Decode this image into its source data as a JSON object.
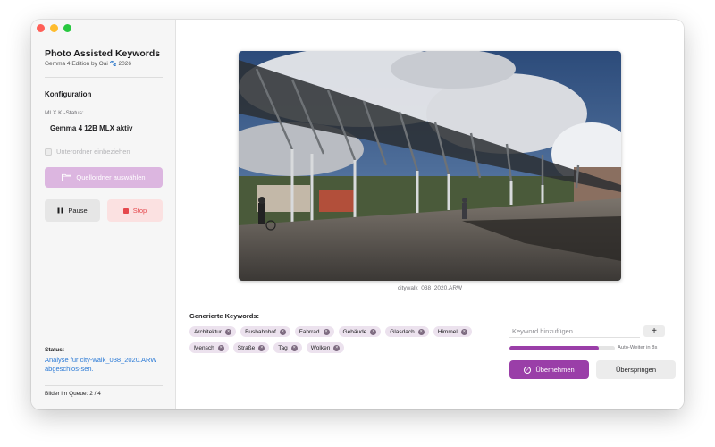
{
  "app": {
    "title": "Photo Assisted Keywords",
    "subtitle": "Gemma 4 Edition by Oai 🐾 2026"
  },
  "sidebar": {
    "config_heading": "Konfiguration",
    "mlx_label": "MLX KI-Status:",
    "mlx_value": "Gemma 4 12B MLX aktiv",
    "subfolder_label": "Unterordner einbeziehen",
    "subfolder_checked": false,
    "folder_button": "Quellordner auswählen",
    "pause_button": "Pause",
    "stop_button": "Stop",
    "status_heading": "Status:",
    "status_text": "Analyse für city-walk_038_2020.ARW abgeschlos-sen.",
    "queue_text": "Bilder im Queue: 2 / 4"
  },
  "main": {
    "filename": "citywalk_038_2020.ARW",
    "keywords_heading": "Generierte Keywords:",
    "keywords": [
      "Architektur",
      "Busbahnhof",
      "Fahrrad",
      "Gebäude",
      "Glasdach",
      "Himmel",
      "Mensch",
      "Straße",
      "Tag",
      "Wolken"
    ],
    "keyword_input_placeholder": "Keyword hinzufügen...",
    "add_button": "+",
    "auto_next_text": "Auto-Weiter in 8s",
    "auto_next_progress": 0.85,
    "accept_button": "Übernehmen",
    "skip_button": "Überspringen"
  },
  "colors": {
    "accent": "#9a3ea8",
    "accent_light": "#dcb6e0",
    "chip_bg": "#ece2ee",
    "stop": "#e5484d",
    "link": "#2b7ad6"
  }
}
